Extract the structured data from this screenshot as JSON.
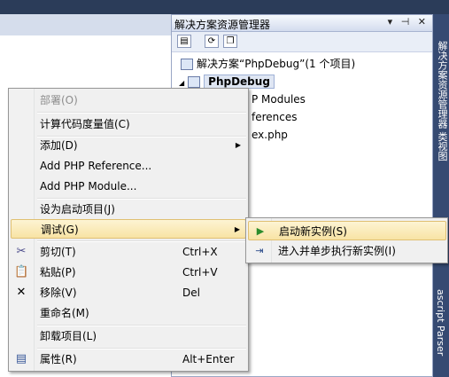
{
  "solution_explorer": {
    "title": "解决方案资源管理器",
    "title_buttons": "▾ ⊣ ✕",
    "solution_label": "解决方案“PhpDebug”(1 个项目)",
    "project_label": "PhpDebug",
    "items": [
      "P Modules",
      "ferences",
      "ex.php"
    ]
  },
  "dock": {
    "top_text": "解决方案资源管理器  类视图",
    "bottom_text": "ascript Parser"
  },
  "context_menu": {
    "items": [
      {
        "label": "部署(O)",
        "disabled": true
      },
      {
        "label": "计算代码度量值(C)"
      },
      {
        "label": "添加(D)",
        "submenu": true
      },
      {
        "label": "Add PHP Reference..."
      },
      {
        "label": "Add PHP Module..."
      },
      {
        "label": "设为启动项目(J)"
      },
      {
        "label": "调试(G)",
        "submenu": true,
        "highlighted": true
      },
      {
        "label": "剪切(T)",
        "shortcut": "Ctrl+X",
        "icon": "scissors-icon"
      },
      {
        "label": "粘贴(P)",
        "shortcut": "Ctrl+V",
        "icon": "paste-icon"
      },
      {
        "label": "移除(V)",
        "shortcut": "Del",
        "icon": "remove-icon"
      },
      {
        "label": "重命名(M)"
      },
      {
        "label": "卸载项目(L)"
      },
      {
        "label": "属性(R)",
        "shortcut": "Alt+Enter",
        "icon": "properties-icon"
      }
    ]
  },
  "debug_submenu": {
    "items": [
      {
        "label": "启动新实例(S)",
        "icon": "play-icon",
        "highlighted": true
      },
      {
        "label": "进入并单步执行新实例(I)",
        "icon": "step-into-icon"
      }
    ]
  },
  "colors": {
    "ide_background": "#293955",
    "menu_highlight": "#f8e3a4",
    "menu_background": "#f0f0f0"
  }
}
